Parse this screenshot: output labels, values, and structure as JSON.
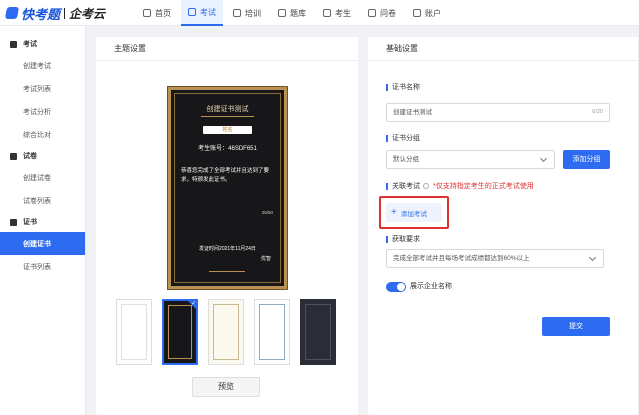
{
  "brand": {
    "name": "快考题",
    "sub": "企考云"
  },
  "nav": [
    {
      "label": "首页",
      "active": false
    },
    {
      "label": "考试",
      "active": true
    },
    {
      "label": "培训",
      "active": false
    },
    {
      "label": "题库",
      "active": false
    },
    {
      "label": "考生",
      "active": false
    },
    {
      "label": "问卷",
      "active": false
    },
    {
      "label": "账户",
      "active": false
    }
  ],
  "sidebar": {
    "groups": [
      {
        "label": "考试",
        "items": [
          "创建考试",
          "考试列表",
          "考试分析",
          "综合比对"
        ]
      },
      {
        "label": "试卷",
        "items": [
          "创建试卷",
          "试卷列表"
        ]
      },
      {
        "label": "证书",
        "items": [
          "创建证书",
          "证书列表"
        ]
      }
    ],
    "active": "创建证书"
  },
  "theme_panel": {
    "title": "主题设置",
    "certificate": {
      "title": "创建证书测试",
      "name_placeholder": "姓名",
      "candidate_no": "考生账号：46SDF651",
      "body": "恭喜您完成了全部考试并且达到了要求，特颁发此证书。",
      "count": "25/50",
      "issue_time": "发证时间2021年11月24日",
      "issuer": "优智"
    },
    "templates": [
      {
        "name": "white",
        "selected": false
      },
      {
        "name": "black-gold",
        "selected": true
      },
      {
        "name": "cream",
        "selected": false
      },
      {
        "name": "blue-frame",
        "selected": false
      },
      {
        "name": "dark",
        "selected": false
      }
    ],
    "preview_label": "预览"
  },
  "basic_panel": {
    "title": "基础设置",
    "cert_name": {
      "label": "证书名称",
      "value": "创建证书测试",
      "counter": "6/20"
    },
    "cert_group": {
      "label": "证书分组",
      "value": "默认分组",
      "add_label": "添加分组"
    },
    "related_exam": {
      "label": "关联考试",
      "note": "*仅支持指定考生的正式考试使用",
      "add_label": "添加考试"
    },
    "requirement": {
      "label": "获取要求",
      "value": "完成全部考试并且每场考试成绩都达到60%以上"
    },
    "show_company": {
      "label": "展示企业名称",
      "on": true
    },
    "submit_label": "提交"
  },
  "colors": {
    "accent": "#2d6cf0",
    "highlight": "#e03131",
    "gold": "#b89153"
  }
}
